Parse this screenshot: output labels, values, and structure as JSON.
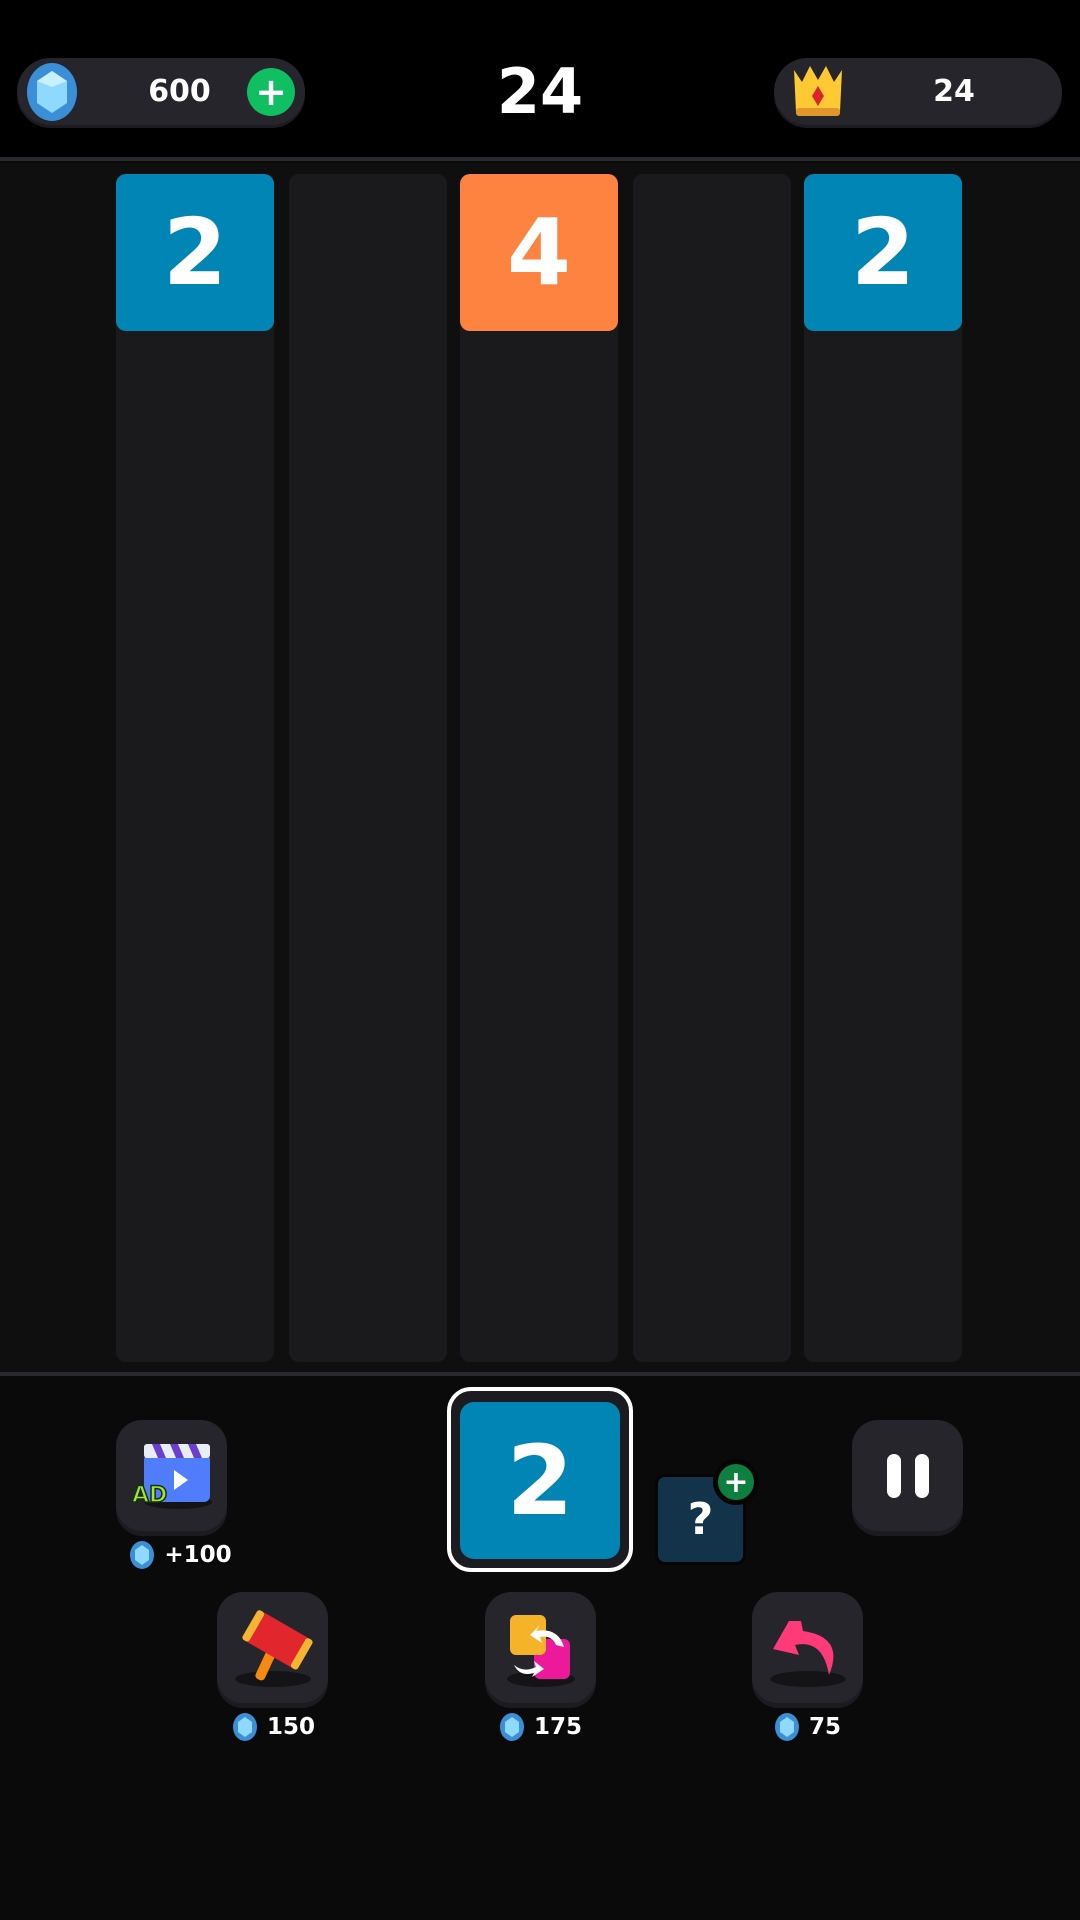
{
  "header": {
    "gems": "600",
    "score": "24",
    "best": "24"
  },
  "board": {
    "columns": [
      {
        "tile": "2",
        "color": "#0085b5"
      },
      {
        "tile": null
      },
      {
        "tile": "4",
        "color": "#ff8340"
      },
      {
        "tile": null
      },
      {
        "tile": "2",
        "color": "#0085b5"
      }
    ]
  },
  "current_tile": {
    "value": "2",
    "color": "#0085b5"
  },
  "next_tile": {
    "value": "?"
  },
  "ad_reward": "+100",
  "powerups": {
    "hammer_cost": "150",
    "swap_cost": "175",
    "undo_cost": "75"
  }
}
